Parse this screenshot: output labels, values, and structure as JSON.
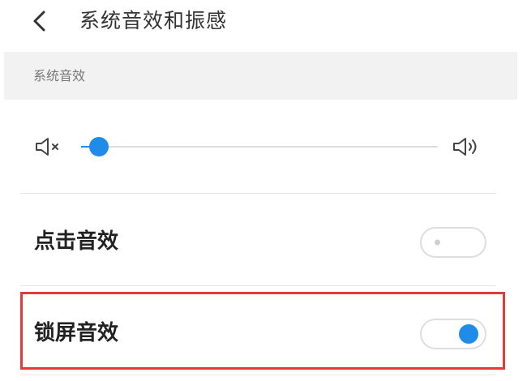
{
  "header": {
    "back_icon": "chevron-left-icon",
    "title": "系统音效和振感"
  },
  "section": {
    "label": "系统音效"
  },
  "volume": {
    "mute_icon": "speaker-mute-icon",
    "loud_icon": "speaker-loud-icon",
    "level_fraction": 0.05
  },
  "settings": [
    {
      "label": "点击音效",
      "enabled": false
    },
    {
      "label": "锁屏音效",
      "enabled": true
    }
  ],
  "colors": {
    "accent": "#1f8ce8",
    "highlight": "#e03a3a",
    "section_bg": "#f2f2f2"
  }
}
